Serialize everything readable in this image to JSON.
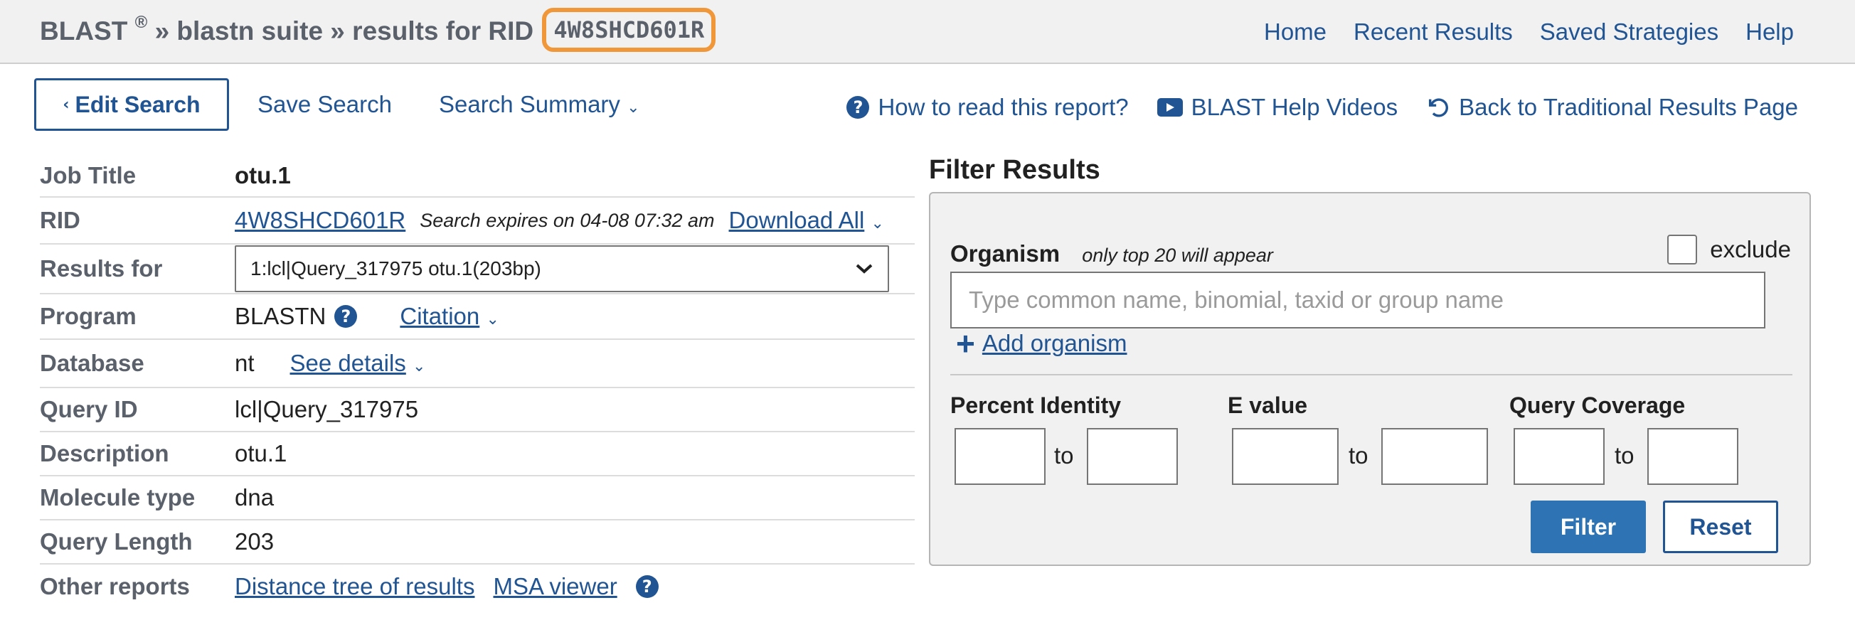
{
  "header": {
    "brand": "BLAST",
    "reg_mark": "®",
    "breadcrumb_suite": " » blastn suite » results for RID ",
    "rid": "4W8SHCD601R",
    "nav": [
      "Home",
      "Recent Results",
      "Saved Strategies",
      "Help"
    ],
    "highlight_color": "#f0973a"
  },
  "toolbar": {
    "edit_search": "Edit Search",
    "save_search": "Save Search",
    "search_summary": "Search Summary",
    "how_to_read": "How to read this report?",
    "help_videos": "BLAST Help Videos",
    "back_traditional": "Back to Traditional Results Page"
  },
  "summary": {
    "job_title": {
      "label": "Job Title",
      "value": "otu.1"
    },
    "rid": {
      "label": "RID",
      "value": "4W8SHCD601R",
      "expires": "Search expires on 04-08 07:32 am",
      "download": "Download All"
    },
    "results_for": {
      "label": "Results for",
      "value": "1:lcl|Query_317975 otu.1(203bp)"
    },
    "program": {
      "label": "Program",
      "value": "BLASTN",
      "citation": "Citation"
    },
    "database": {
      "label": "Database",
      "value": "nt",
      "details": "See details"
    },
    "query_id": {
      "label": "Query ID",
      "value": "lcl|Query_317975"
    },
    "description": {
      "label": "Description",
      "value": "otu.1"
    },
    "molecule_type": {
      "label": "Molecule type",
      "value": "dna"
    },
    "query_length": {
      "label": "Query Length",
      "value": "203"
    },
    "other_reports": {
      "label": "Other reports",
      "distance_tree": "Distance tree of results",
      "msa_viewer": "MSA viewer"
    }
  },
  "filter": {
    "title": "Filter Results",
    "organism_label": "Organism",
    "organism_note": "only top 20 will appear",
    "exclude_label": "exclude",
    "organism_placeholder": "Type common  name, binomial, taxid or group  name",
    "add_organism": "Add organism",
    "percent_identity": "Percent Identity",
    "e_value": "E value",
    "query_coverage": "Query Coverage",
    "to": "to",
    "filter_button": "Filter",
    "reset_button": "Reset"
  },
  "colors": {
    "link": "#205493",
    "primary_button": "#2e74b5"
  }
}
